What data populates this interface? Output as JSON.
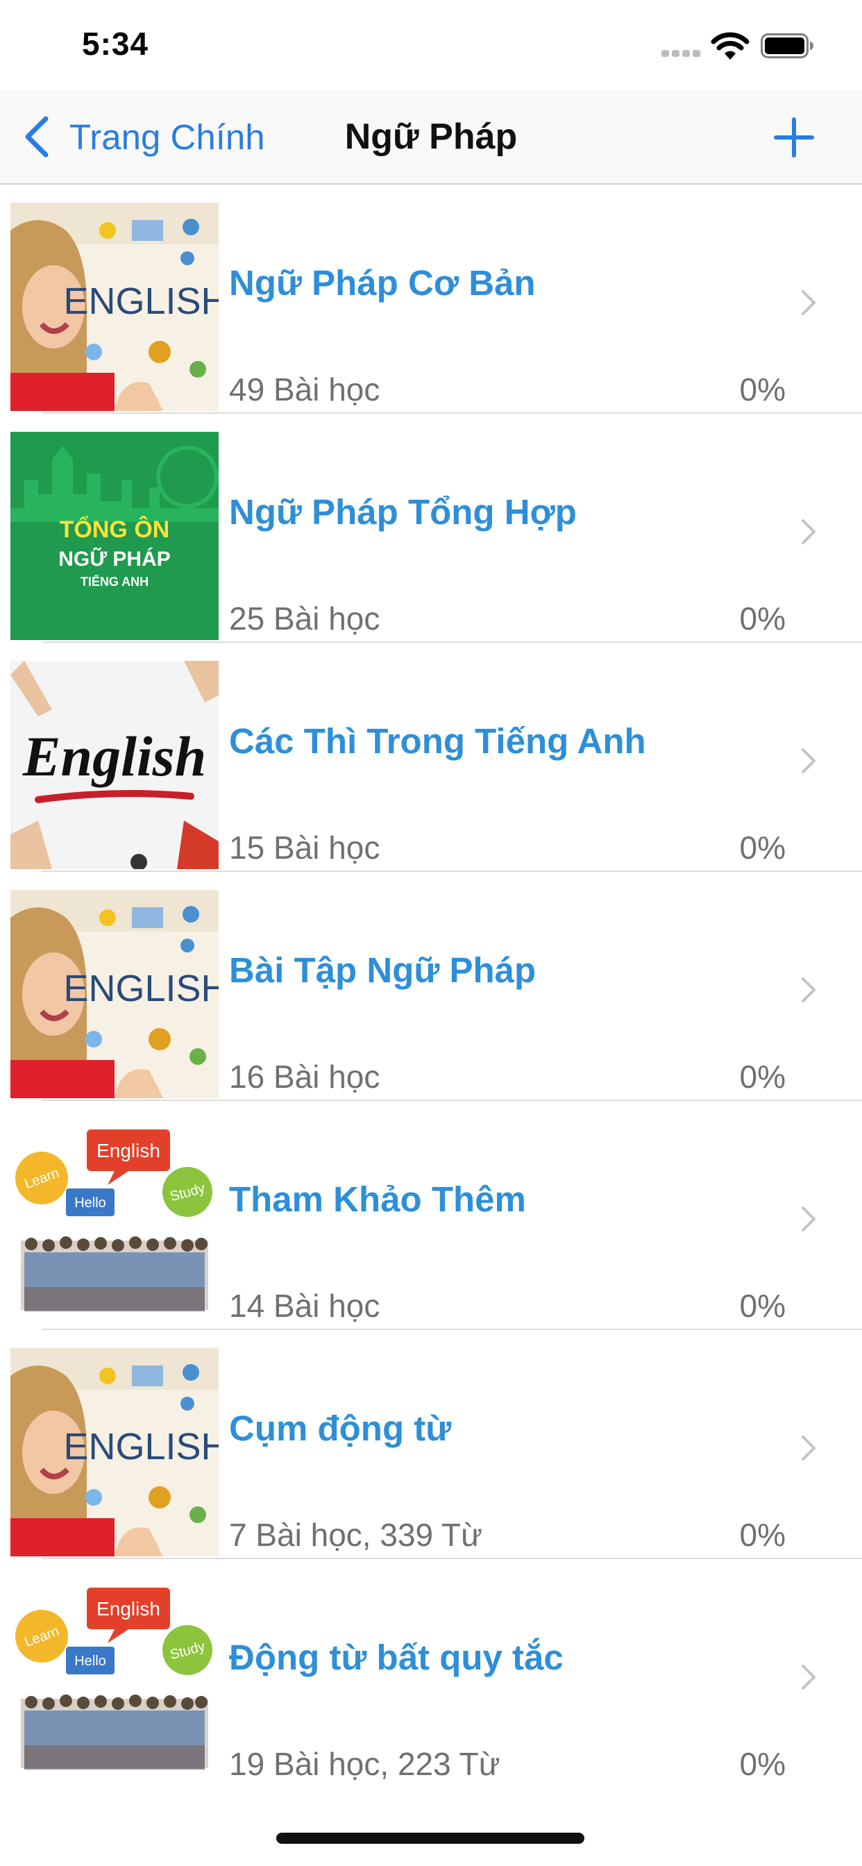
{
  "status_bar": {
    "time": "5:34"
  },
  "nav": {
    "back_label": "Trang Chính",
    "title": "Ngữ Pháp"
  },
  "colors": {
    "accent": "#2a7de1",
    "title_blue": "#2e8fd8",
    "muted": "#707070"
  },
  "rows": [
    {
      "title": "Ngữ Pháp Cơ Bản",
      "subtitle": "49 Bài học",
      "progress": "0%",
      "thumbnail": "english-girl-thumbnail"
    },
    {
      "title": "Ngữ Pháp Tổng Hợp",
      "subtitle": "25 Bài học",
      "progress": "0%",
      "thumbnail": "tong-on-thumbnail",
      "thumb_text": {
        "line1": "TỔNG ÔN",
        "line2": "NGỮ PHÁP",
        "line3": "TIẾNG ANH"
      }
    },
    {
      "title": "Các Thì Trong Tiếng Anh",
      "subtitle": "15 Bài học",
      "progress": "0%",
      "thumbnail": "english-sign-thumbnail",
      "thumb_text": {
        "word": "English"
      }
    },
    {
      "title": "Bài Tập Ngữ Pháp",
      "subtitle": "16 Bài học",
      "progress": "0%",
      "thumbnail": "english-girl-thumbnail"
    },
    {
      "title": "Tham Khảo Thêm",
      "subtitle": "14 Bài học",
      "progress": "0%",
      "thumbnail": "speech-bubbles-thumbnail",
      "thumb_text": {
        "english": "English",
        "learn": "Learn",
        "hello": "Hello",
        "study": "Study"
      }
    },
    {
      "title": "Cụm động từ",
      "subtitle": "7 Bài học, 339 Từ",
      "progress": "0%",
      "thumbnail": "english-girl-thumbnail"
    },
    {
      "title": "Động từ bất quy tắc",
      "subtitle": "19 Bài học, 223 Từ",
      "progress": "0%",
      "thumbnail": "speech-bubbles-thumbnail",
      "thumb_text": {
        "english": "English",
        "learn": "Learn",
        "hello": "Hello",
        "study": "Study"
      }
    }
  ],
  "girl_thumb_text": "ENGLISH"
}
